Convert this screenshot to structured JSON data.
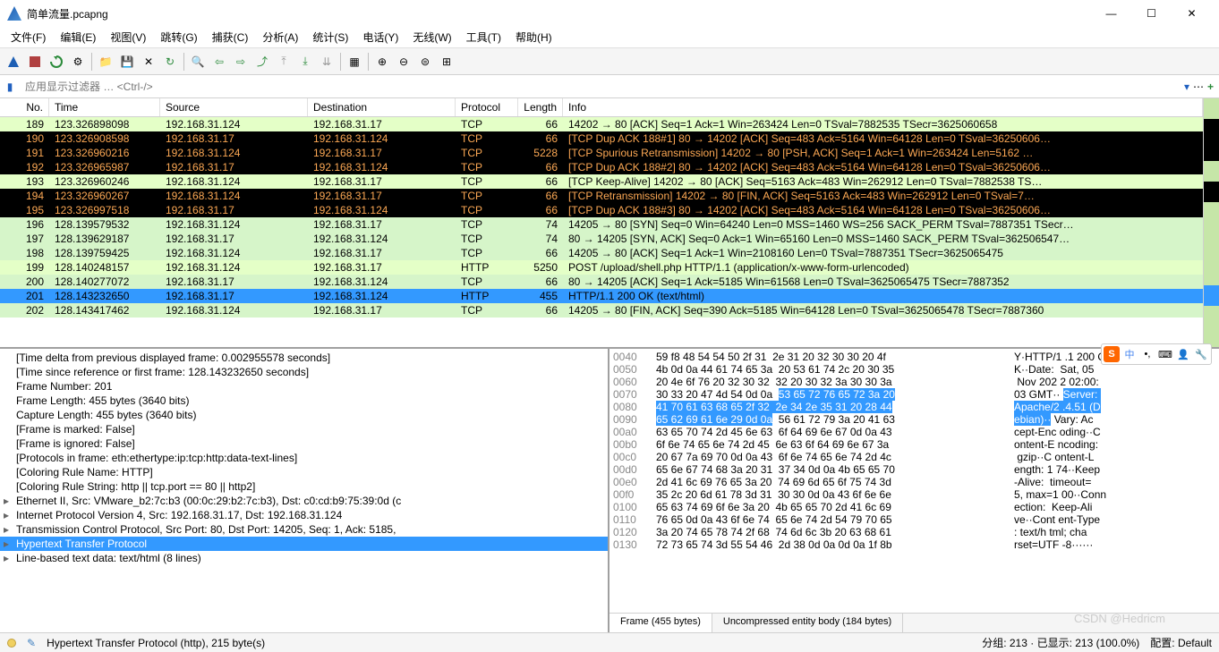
{
  "window": {
    "title": "简单流量.pcapng"
  },
  "menu": [
    "文件(F)",
    "编辑(E)",
    "视图(V)",
    "跳转(G)",
    "捕获(C)",
    "分析(A)",
    "统计(S)",
    "电话(Y)",
    "无线(W)",
    "工具(T)",
    "帮助(H)"
  ],
  "filter": {
    "placeholder": "应用显示过滤器 … <Ctrl-/>"
  },
  "columns": [
    "No.",
    "Time",
    "Source",
    "Destination",
    "Protocol",
    "Length",
    "Info"
  ],
  "packets": [
    {
      "no": "189",
      "time": "123.326898098",
      "src": "192.168.31.124",
      "dst": "192.168.31.17",
      "proto": "TCP",
      "len": "66",
      "info": "14202 → 80 [ACK] Seq=1 Ack=1 Win=263424 Len=0 TSval=7882535 TSecr=3625060658",
      "cls": "bg-green"
    },
    {
      "no": "190",
      "time": "123.326908598",
      "src": "192.168.31.17",
      "dst": "192.168.31.124",
      "proto": "TCP",
      "len": "66",
      "info": "[TCP Dup ACK 188#1] 80 → 14202 [ACK] Seq=483 Ack=5164 Win=64128 Len=0 TSval=36250606…",
      "cls": "bg-black"
    },
    {
      "no": "191",
      "time": "123.326960216",
      "src": "192.168.31.124",
      "dst": "192.168.31.17",
      "proto": "TCP",
      "len": "5228",
      "info": "[TCP Spurious Retransmission] 14202 → 80 [PSH, ACK] Seq=1 Ack=1 Win=263424 Len=5162 …",
      "cls": "bg-black"
    },
    {
      "no": "192",
      "time": "123.326965987",
      "src": "192.168.31.17",
      "dst": "192.168.31.124",
      "proto": "TCP",
      "len": "66",
      "info": "[TCP Dup ACK 188#2] 80 → 14202 [ACK] Seq=483 Ack=5164 Win=64128 Len=0 TSval=36250606…",
      "cls": "bg-black"
    },
    {
      "no": "193",
      "time": "123.326960246",
      "src": "192.168.31.124",
      "dst": "192.168.31.17",
      "proto": "TCP",
      "len": "66",
      "info": "[TCP Keep-Alive] 14202 → 80 [ACK] Seq=5163 Ack=483 Win=262912 Len=0 TSval=7882538 TS…",
      "cls": "bg-green"
    },
    {
      "no": "194",
      "time": "123.326960267",
      "src": "192.168.31.124",
      "dst": "192.168.31.17",
      "proto": "TCP",
      "len": "66",
      "info": "[TCP Retransmission] 14202 → 80 [FIN, ACK] Seq=5163 Ack=483 Win=262912 Len=0 TSval=7…",
      "cls": "bg-black"
    },
    {
      "no": "195",
      "time": "123.326997518",
      "src": "192.168.31.17",
      "dst": "192.168.31.124",
      "proto": "TCP",
      "len": "66",
      "info": "[TCP Dup ACK 188#3] 80 → 14202 [ACK] Seq=483 Ack=5164 Win=64128 Len=0 TSval=36250606…",
      "cls": "bg-black"
    },
    {
      "no": "196",
      "time": "128.139579532",
      "src": "192.168.31.124",
      "dst": "192.168.31.17",
      "proto": "TCP",
      "len": "74",
      "info": "14205 → 80 [SYN] Seq=0 Win=64240 Len=0 MSS=1460 WS=256 SACK_PERM TSval=7887351 TSecr…",
      "cls": "bg-green2"
    },
    {
      "no": "197",
      "time": "128.139629187",
      "src": "192.168.31.17",
      "dst": "192.168.31.124",
      "proto": "TCP",
      "len": "74",
      "info": "80 → 14205 [SYN, ACK] Seq=0 Ack=1 Win=65160 Len=0 MSS=1460 SACK_PERM TSval=362506547…",
      "cls": "bg-green2"
    },
    {
      "no": "198",
      "time": "128.139759425",
      "src": "192.168.31.124",
      "dst": "192.168.31.17",
      "proto": "TCP",
      "len": "66",
      "info": "14205 → 80 [ACK] Seq=1 Ack=1 Win=2108160 Len=0 TSval=7887351 TSecr=3625065475",
      "cls": "bg-green2"
    },
    {
      "no": "199",
      "time": "128.140248157",
      "src": "192.168.31.124",
      "dst": "192.168.31.17",
      "proto": "HTTP",
      "len": "5250",
      "info": "POST /upload/shell.php HTTP/1.1  (application/x-www-form-urlencoded)",
      "cls": "bg-green"
    },
    {
      "no": "200",
      "time": "128.140277072",
      "src": "192.168.31.17",
      "dst": "192.168.31.124",
      "proto": "TCP",
      "len": "66",
      "info": "80 → 14205 [ACK] Seq=1 Ack=5185 Win=61568 Len=0 TSval=3625065475 TSecr=7887352",
      "cls": "bg-green2"
    },
    {
      "no": "201",
      "time": "128.143232650",
      "src": "192.168.31.17",
      "dst": "192.168.31.124",
      "proto": "HTTP",
      "len": "455",
      "info": "HTTP/1.1 200 OK  (text/html)",
      "cls": "bg-sel"
    },
    {
      "no": "202",
      "time": "128.143417462",
      "src": "192.168.31.124",
      "dst": "192.168.31.17",
      "proto": "TCP",
      "len": "66",
      "info": "14205 → 80 [FIN, ACK] Seq=390 Ack=5185 Win=64128 Len=0 TSval=3625065478 TSecr=7887360",
      "cls": "bg-green2"
    }
  ],
  "details": [
    {
      "t": "[Time delta from previous displayed frame: 0.002955578 seconds]"
    },
    {
      "t": "[Time since reference or first frame: 128.143232650 seconds]"
    },
    {
      "t": "Frame Number: 201"
    },
    {
      "t": "Frame Length: 455 bytes (3640 bits)"
    },
    {
      "t": "Capture Length: 455 bytes (3640 bits)"
    },
    {
      "t": "[Frame is marked: False]"
    },
    {
      "t": "[Frame is ignored: False]"
    },
    {
      "t": "[Protocols in frame: eth:ethertype:ip:tcp:http:data-text-lines]"
    },
    {
      "t": "[Coloring Rule Name: HTTP]"
    },
    {
      "t": "[Coloring Rule String: http || tcp.port == 80 || http2]"
    },
    {
      "t": "Ethernet II, Src: VMware_b2:7c:b3 (00:0c:29:b2:7c:b3), Dst: c0:cd:b9:75:39:0d (c",
      "exp": true
    },
    {
      "t": "Internet Protocol Version 4, Src: 192.168.31.17, Dst: 192.168.31.124",
      "exp": true
    },
    {
      "t": "Transmission Control Protocol, Src Port: 80, Dst Port: 14205, Seq: 1, Ack: 5185,",
      "exp": true
    },
    {
      "t": "Hypertext Transfer Protocol",
      "exp": true,
      "sel": true
    },
    {
      "t": "Line-based text data: text/html (8 lines)",
      "exp": true
    }
  ],
  "hex": [
    {
      "off": "0040",
      "b": "59 f8 48 54 54 50 2f 31  2e 31 20 32 30 30 20 4f",
      "a": "Y·HTTP/1 .1 200 O"
    },
    {
      "off": "0050",
      "b": "4b 0d 0a 44 61 74 65 3a  20 53 61 74 2c 20 30 35",
      "a": "K··Date:  Sat, 05"
    },
    {
      "off": "0060",
      "b": "20 4e 6f 76 20 32 30 32  32 20 30 32 3a 30 30 3a",
      "a": " Nov 202 2 02:00:"
    },
    {
      "off": "0070",
      "b": "30 33 20 47 4d 54 0d 0a  ",
      "hb": "53 65 72 76 65 72 3a 20",
      "a": "03 GMT·· ",
      "ha": "Server: "
    },
    {
      "off": "0080",
      "hb2": "41 70 61 63 68 65 2f 32  2e 34 2e 35 31 20 28 44",
      "ha2": "Apache/2 .4.51 (D"
    },
    {
      "off": "0090",
      "hb2": "65 62 69 61 6e 29 0d 0a",
      "b2": "  56 61 72 79 3a 20 41 63",
      "ha2": "ebian)··",
      "a2": " Vary: Ac"
    },
    {
      "off": "00a0",
      "b": "63 65 70 74 2d 45 6e 63  6f 64 69 6e 67 0d 0a 43",
      "a": "cept-Enc oding··C"
    },
    {
      "off": "00b0",
      "b": "6f 6e 74 65 6e 74 2d 45  6e 63 6f 64 69 6e 67 3a",
      "a": "ontent-E ncoding:"
    },
    {
      "off": "00c0",
      "b": "20 67 7a 69 70 0d 0a 43  6f 6e 74 65 6e 74 2d 4c",
      "a": " gzip··C ontent-L"
    },
    {
      "off": "00d0",
      "b": "65 6e 67 74 68 3a 20 31  37 34 0d 0a 4b 65 65 70",
      "a": "ength: 1 74··Keep"
    },
    {
      "off": "00e0",
      "b": "2d 41 6c 69 76 65 3a 20  74 69 6d 65 6f 75 74 3d",
      "a": "-Alive:  timeout="
    },
    {
      "off": "00f0",
      "b": "35 2c 20 6d 61 78 3d 31  30 30 0d 0a 43 6f 6e 6e",
      "a": "5, max=1 00··Conn"
    },
    {
      "off": "0100",
      "b": "65 63 74 69 6f 6e 3a 20  4b 65 65 70 2d 41 6c 69",
      "a": "ection:  Keep-Ali"
    },
    {
      "off": "0110",
      "b": "76 65 0d 0a 43 6f 6e 74  65 6e 74 2d 54 79 70 65",
      "a": "ve··Cont ent-Type"
    },
    {
      "off": "0120",
      "b": "3a 20 74 65 78 74 2f 68  74 6d 6c 3b 20 63 68 61",
      "a": ": text/h tml; cha"
    },
    {
      "off": "0130",
      "b": "72 73 65 74 3d 55 54 46  2d 38 0d 0a 0d 0a 1f 8b",
      "a": "rset=UTF -8······"
    }
  ],
  "hextabs": [
    "Frame (455 bytes)",
    "Uncompressed entity body (184 bytes)"
  ],
  "status": {
    "sel": "Hypertext Transfer Protocol (http), 215 byte(s)",
    "pkts": "分组: 213 · 已显示: 213 (100.0%)",
    "profile": "配置: Default"
  },
  "watermark": "CSDN @Hedricm"
}
